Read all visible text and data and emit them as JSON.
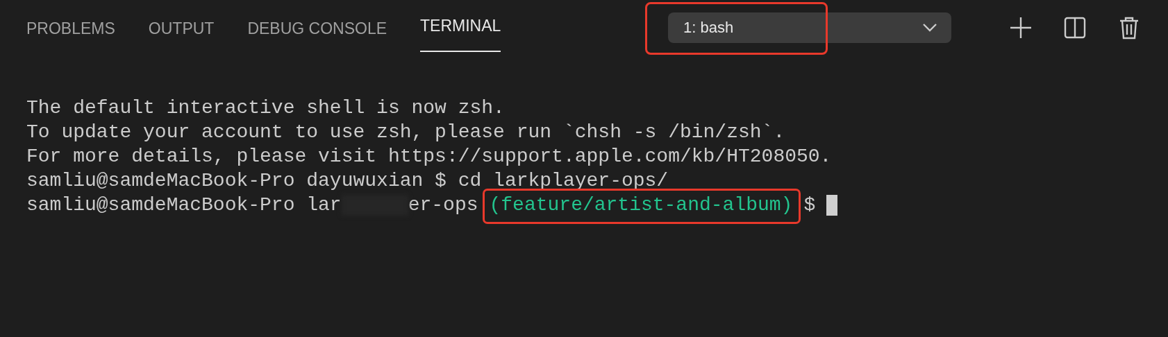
{
  "tabs": [
    {
      "label": "PROBLEMS",
      "selected": false
    },
    {
      "label": "OUTPUT",
      "selected": false
    },
    {
      "label": "DEBUG CONSOLE",
      "selected": false
    },
    {
      "label": "TERMINAL",
      "selected": true
    }
  ],
  "terminal_select": {
    "value": "1: bash",
    "annotated": true
  },
  "terminal": {
    "lines": [
      {
        "kind": "plain",
        "text": "The default interactive shell is now zsh."
      },
      {
        "kind": "plain",
        "text": "To update your account to use zsh, please run `chsh -s /bin/zsh`."
      },
      {
        "kind": "plain",
        "text": "For more details, please visit https://support.apple.com/kb/HT208050."
      },
      {
        "kind": "plain",
        "text": "samliu@samdeMacBook-Pro dayuwuxian $ cd larkplayer-ops/"
      },
      {
        "kind": "prompt",
        "before": "samliu@samdeMacBook-Pro lar",
        "redacted": true,
        "after": "er-ops",
        "branch": "(feature/artist-and-album)",
        "branch_annotated": true,
        "symbol": "$",
        "cursor": true
      }
    ]
  }
}
